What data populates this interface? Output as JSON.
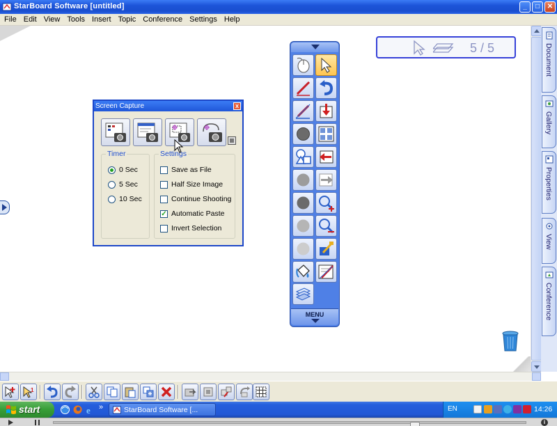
{
  "window": {
    "title": "StarBoard Software [untitled]",
    "min_label": "_",
    "max_label": "□",
    "close_label": "✕"
  },
  "menu": {
    "items": [
      "File",
      "Edit",
      "View",
      "Tools",
      "Insert",
      "Topic",
      "Conference",
      "Settings",
      "Help"
    ]
  },
  "page_indicator": {
    "text": "5 / 5"
  },
  "side_tabs": {
    "items": [
      "Document",
      "Gallery",
      "Properties",
      "View",
      "Conference"
    ]
  },
  "floating_toolbar": {
    "menu_label": "MENU"
  },
  "screen_capture": {
    "title": "Screen Capture",
    "close_label": "x",
    "timer_title": "Timer",
    "timer_options": [
      "0 Sec",
      "5 Sec",
      "10 Sec"
    ],
    "timer_selected": 0,
    "settings_title": "Settings",
    "settings_options": [
      "Save as File",
      "Half Size Image",
      "Continue Shooting",
      "Automatic Paste",
      "Invert Selection"
    ],
    "settings_checked": [
      false,
      false,
      false,
      true,
      false
    ]
  },
  "taskbar": {
    "start_label": "start",
    "task_label": "StarBoard Software [...",
    "more_label": "»",
    "lang": "EN",
    "clock": "14:26"
  },
  "media": {
    "info_label": "i"
  },
  "colors": {
    "xp_blue": "#245edc",
    "toolbar_blue": "#4f80e6",
    "accent_blue": "#1f4fd0",
    "check_green": "#21a121",
    "start_green": "#379e37"
  }
}
